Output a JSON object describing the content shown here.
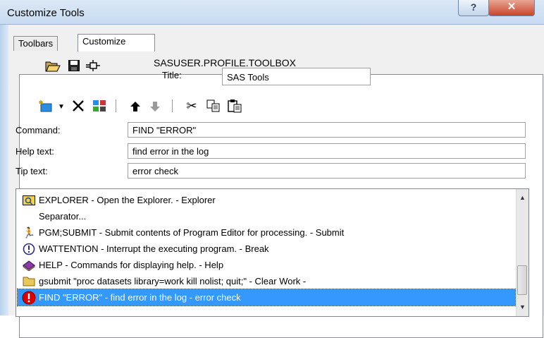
{
  "window": {
    "title": "Customize Tools",
    "help_label": "?",
    "close_label": "✕"
  },
  "tabs": [
    {
      "label": "Toolbars"
    },
    {
      "label": "Customize",
      "active": true
    }
  ],
  "profile": {
    "name": "SASUSER.PROFILE.TOOLBOX",
    "title_label": "Title:",
    "title_value": "SAS Tools"
  },
  "toolbar_icons": [
    "add-tool-icon",
    "dropdown-arrow-icon",
    "delete-icon",
    "change-icon",
    "move-up-icon",
    "move-down-icon",
    "cut-icon",
    "copy-icon",
    "paste-icon"
  ],
  "form": {
    "command_label": "Command:",
    "command_value": "FIND \"ERROR\"",
    "help_label": "Help text:",
    "help_value": "find error in the log",
    "tip_label": "Tip text:",
    "tip_value": "error check"
  },
  "tools_list": [
    {
      "text": "EXPLORER - Open the Explorer. - Explorer",
      "icon": "explorer-icon"
    },
    {
      "text": "Separator...",
      "icon": ""
    },
    {
      "text": "PGM;SUBMIT - Submit contents of Program Editor for processing. - Submit",
      "icon": "running-man-icon"
    },
    {
      "text": "WATTENTION - Interrupt the executing program. - Break",
      "icon": "attention-icon"
    },
    {
      "text": "HELP - Commands for displaying help. - Help",
      "icon": "help-book-icon"
    },
    {
      "text": "gsubmit \"proc datasets library=work kill nolist; quit;\" - Clear Work -",
      "icon": "folder-icon"
    },
    {
      "text": "FIND \"ERROR\" - find error in the log - error check",
      "icon": "error-icon",
      "selected": true
    }
  ],
  "colors": {
    "selection": "#3399ff",
    "titlebar": "#c7dbf1",
    "close": "#c9452c"
  }
}
